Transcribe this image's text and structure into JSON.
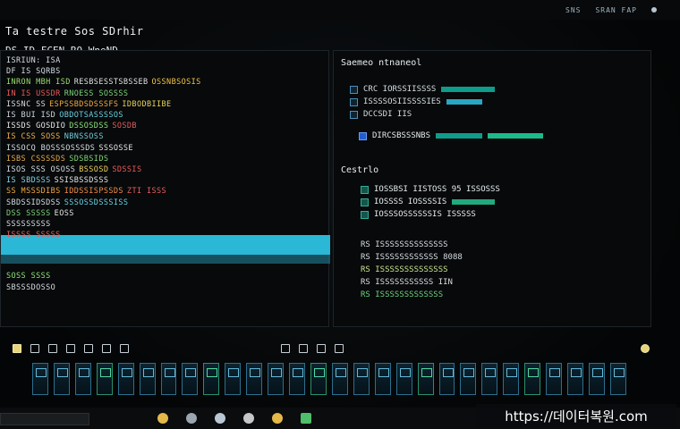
{
  "window": {
    "title": "Ta testre Sos SDrhir",
    "subtitle": "DS ID FCEN RO WneND"
  },
  "tray": [
    "SNS",
    "SRAN FAP"
  ],
  "left_pane": {
    "lines": [
      {
        "segs": [
          {
            "t": "ISRIUN: ISA",
            "c": "#d6dde2"
          }
        ]
      },
      {
        "segs": [
          {
            "t": "DF IS SQRBS",
            "c": "#d6dde2"
          }
        ]
      },
      {
        "segs": [
          {
            "t": "INRON MBH ISD",
            "c": "#9edc72"
          },
          {
            "t": "RESBSESSTSBSSEB",
            "c": "#e0e0e0"
          },
          {
            "t": "OSSNBSOSIS",
            "c": "#f0c24a"
          }
        ]
      },
      {
        "segs": [
          {
            "t": "IN IS USSDR",
            "c": "#e85a5a"
          },
          {
            "t": "RNOESS SOSSSS",
            "c": "#7fd27c"
          }
        ]
      },
      {
        "segs": [
          {
            "t": "ISSNC SS",
            "c": "#d6dde2"
          },
          {
            "t": "ESPSSBDSDSSSFS",
            "c": "#f2a843"
          },
          {
            "t": "IDBODBIIBE",
            "c": "#e9d35b"
          }
        ]
      },
      {
        "segs": [
          {
            "t": "IS BUI ISD",
            "c": "#cfd6db"
          },
          {
            "t": "OBDOTSASSSSOS",
            "c": "#6bd0e0"
          }
        ]
      },
      {
        "segs": [
          {
            "t": "ISSDS GOSDIO",
            "c": "#e8e8e8"
          },
          {
            "t": "DSSOSDSS",
            "c": "#8ee37b"
          },
          {
            "t": "SOSDB",
            "c": "#e35f5f"
          }
        ]
      },
      {
        "segs": [
          {
            "t": "IS CSS SOSS",
            "c": "#f0b04c"
          },
          {
            "t": "NBNSSOSS",
            "c": "#6fcbd8"
          }
        ]
      },
      {
        "segs": [
          {
            "t": "ISSOCQ BOSSSOSSSDS",
            "c": "#d6dde2"
          },
          {
            "t": "SSSOSSE",
            "c": "#e4e4e4"
          }
        ]
      },
      {
        "segs": [
          {
            "t": "ISBS CSSSSDS",
            "c": "#e5a84b"
          },
          {
            "t": "SDSBSIDS",
            "c": "#7ed672"
          }
        ]
      },
      {
        "segs": [
          {
            "t": "ISOS SSS OSOSS",
            "c": "#d6dde2"
          },
          {
            "t": "BSSOSD",
            "c": "#e9d35b"
          },
          {
            "t": "SDSSIS",
            "c": "#e85a5a"
          }
        ]
      },
      {
        "segs": [
          {
            "t": "IS SBDSSS",
            "c": "#89d2e0"
          },
          {
            "t": "SSISBSSDSSS",
            "c": "#e4e4e4"
          }
        ]
      },
      {
        "segs": [
          {
            "t": "SS MSSSDIBS",
            "c": "#f2a843"
          },
          {
            "t": "IDDSSISPSSDS",
            "c": "#f28d4a"
          },
          {
            "t": "ZTI ISSS",
            "c": "#e35f5f"
          }
        ]
      },
      {
        "segs": [
          {
            "t": "SBDSSIDSDSS",
            "c": "#d6dde2"
          },
          {
            "t": "SSSOSSDSSSISS",
            "c": "#6bd0e0"
          }
        ]
      },
      {
        "segs": [
          {
            "t": "DSS SSSSS",
            "c": "#7fd27c"
          },
          {
            "t": "EOSS",
            "c": "#e4e4e4"
          }
        ]
      },
      {
        "segs": [
          {
            "t": "SSSSSSSSS",
            "c": "#d6dde2"
          }
        ]
      },
      {
        "segs": [
          {
            "t": "ISSSS SSSSS",
            "c": "#e35f5f"
          }
        ]
      },
      {
        "segs": [
          {
            "t": "SOSS SSSS",
            "c": "#8ee37b"
          }
        ]
      },
      {
        "segs": [
          {
            "t": "SBSSSDOSSO",
            "c": "#d6dde2"
          }
        ]
      }
    ]
  },
  "right_pane": {
    "heading": "Saemeo ntnaneol",
    "items_a": [
      {
        "label": "CRC IORSSIISSSS",
        "icon": "file-icon"
      },
      {
        "label": "ISSSSOSIISSSSIES",
        "icon": "file-icon"
      },
      {
        "label": "DCCSDI IIS",
        "icon": "file-icon"
      }
    ],
    "item_b": "DIRCSBSSSNBS",
    "heading2": "Cestrlo",
    "items_c": [
      {
        "label": "IOSSBSI IISTOSS 95 ISSOSSS",
        "icon": "folder-icon"
      },
      {
        "label": "IOSSSS IOSSSSIS",
        "icon": "folder-icon"
      },
      {
        "label": "IOSSSOSSSSSSIS ISSSSS",
        "icon": "folder-icon"
      }
    ],
    "items_d": [
      "RS ISSSSSSSSSSSSSS",
      "RS ISSSSSSSSSSSS 8088",
      "RS ISSSSSSSSSSSSSS",
      "RS ISSSSSSSSSSS IIN",
      "RS ISSSSSSSSSSSSS"
    ]
  },
  "watermark": "https://데이터복원.com",
  "colors": {
    "selection": "#2bb7d6",
    "accent": "#0f9c8a"
  }
}
